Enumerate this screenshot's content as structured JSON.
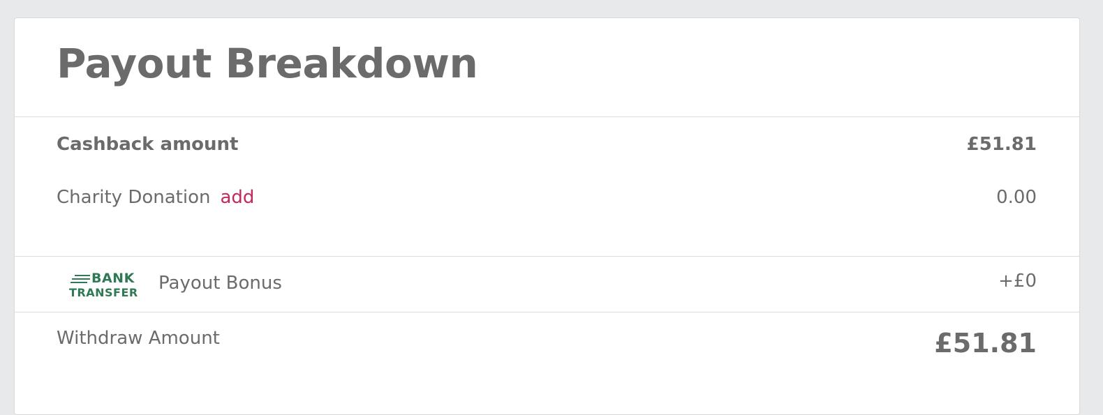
{
  "header": {
    "title": "Payout Breakdown"
  },
  "cashback": {
    "label": "Cashback amount",
    "value": "£51.81"
  },
  "charity": {
    "label": "Charity Donation",
    "add_label": "add",
    "value": "0.00"
  },
  "bonus": {
    "logo_line_1": "BANK",
    "logo_line_2": "TRANSFER",
    "label": "Payout Bonus",
    "value": "+£0"
  },
  "withdraw": {
    "label": "Withdraw Amount",
    "value": "£51.81"
  },
  "colors": {
    "text": "#6b6b6b",
    "link": "#c5285b",
    "bank_green": "#2f7a55",
    "background": "#e8e9eb",
    "card": "#ffffff"
  }
}
